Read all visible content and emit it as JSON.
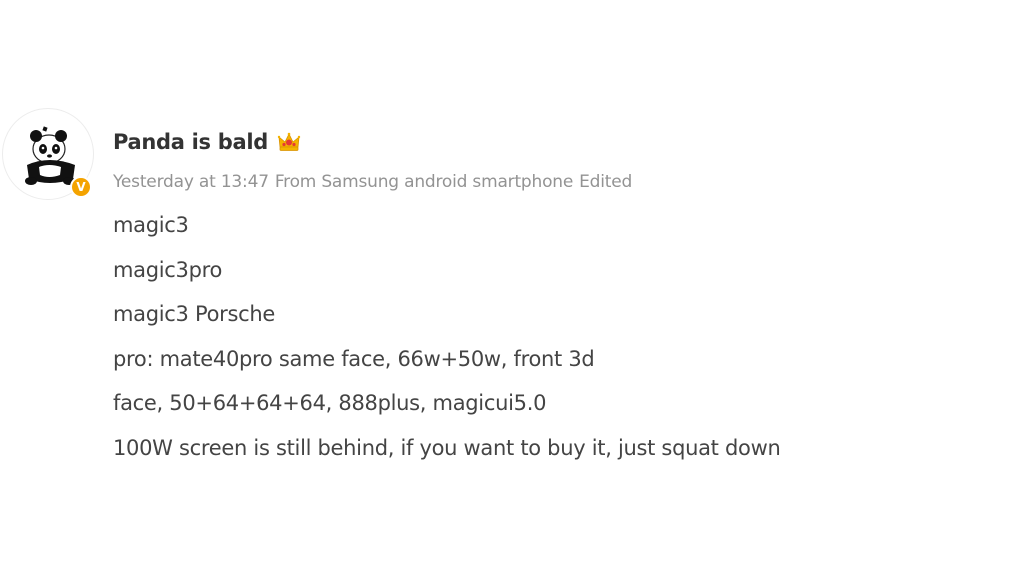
{
  "post": {
    "username": "Panda is bald",
    "badge_letter": "V",
    "timestamp": "Yesterday at 13:47",
    "source": "From Samsung android smartphone",
    "edited": "Edited",
    "lines": [
      "magic3",
      "magic3pro",
      "magic3 Porsche",
      "pro: mate40pro same face, 66w+50w, front 3d",
      "face, 50+64+64+64, 888plus, magicui5.0",
      "100W screen is still behind, if you want to buy it, just squat down"
    ]
  },
  "colors": {
    "badge": "#f4a300",
    "username": "#333333",
    "meta": "#939393",
    "content": "#444444"
  },
  "icons": {
    "avatar": "panda-avatar",
    "verified": "verified-v-badge-icon",
    "crown": "crown-icon"
  }
}
